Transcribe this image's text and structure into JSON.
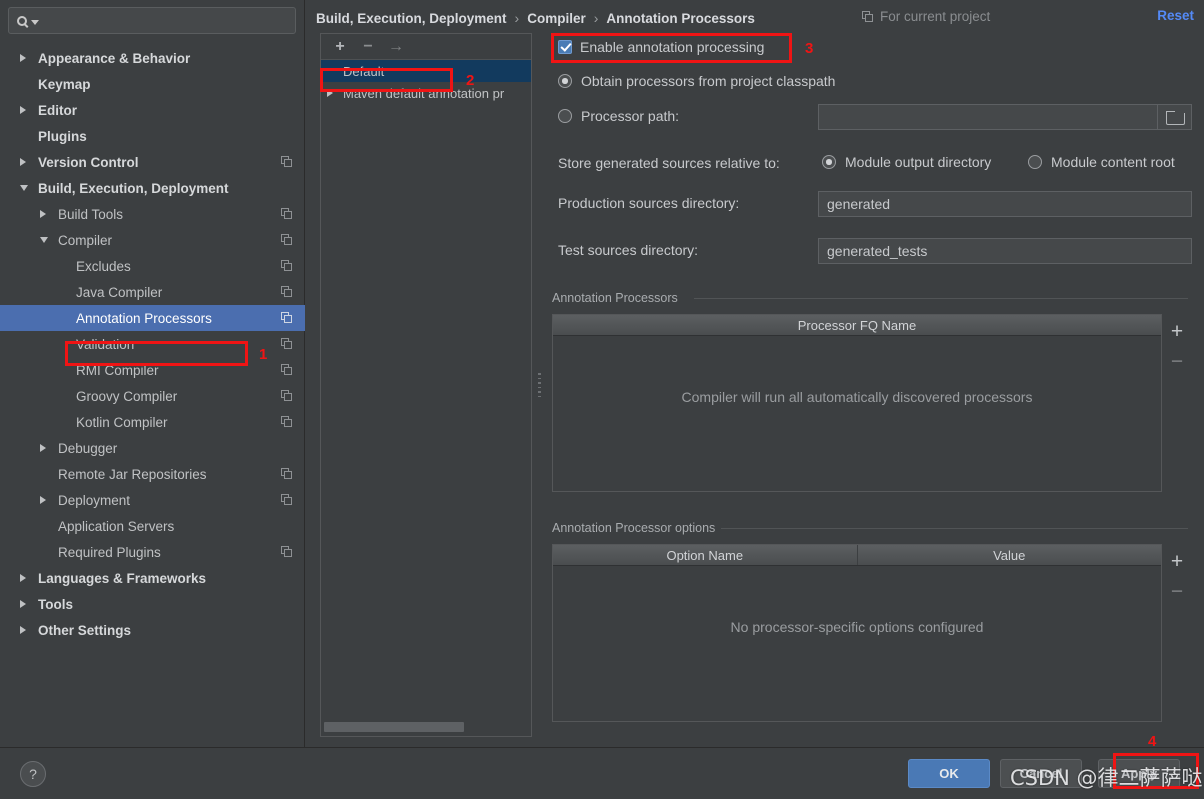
{
  "search": {
    "placeholder": "",
    "value": "",
    "icon": "search-icon"
  },
  "sidebar": {
    "items": [
      {
        "label": "Appearance & Behavior",
        "indent": 0,
        "arrow": "collapsed",
        "bold": true,
        "copy": false,
        "selected": false
      },
      {
        "label": "Keymap",
        "indent": 0,
        "arrow": "none",
        "bold": true,
        "copy": false,
        "selected": false
      },
      {
        "label": "Editor",
        "indent": 0,
        "arrow": "collapsed",
        "bold": true,
        "copy": false,
        "selected": false
      },
      {
        "label": "Plugins",
        "indent": 0,
        "arrow": "none",
        "bold": true,
        "copy": false,
        "selected": false
      },
      {
        "label": "Version Control",
        "indent": 0,
        "arrow": "collapsed",
        "bold": true,
        "copy": true,
        "selected": false
      },
      {
        "label": "Build, Execution, Deployment",
        "indent": 0,
        "arrow": "expanded",
        "bold": true,
        "copy": false,
        "selected": false
      },
      {
        "label": "Build Tools",
        "indent": 1,
        "arrow": "collapsed",
        "bold": false,
        "copy": true,
        "selected": false
      },
      {
        "label": "Compiler",
        "indent": 1,
        "arrow": "expanded",
        "bold": false,
        "copy": true,
        "selected": false
      },
      {
        "label": "Excludes",
        "indent": 2,
        "arrow": "none",
        "bold": false,
        "copy": true,
        "selected": false
      },
      {
        "label": "Java Compiler",
        "indent": 2,
        "arrow": "none",
        "bold": false,
        "copy": true,
        "selected": false
      },
      {
        "label": "Annotation Processors",
        "indent": 2,
        "arrow": "none",
        "bold": false,
        "copy": true,
        "selected": true
      },
      {
        "label": "Validation",
        "indent": 2,
        "arrow": "none",
        "bold": false,
        "copy": true,
        "selected": false
      },
      {
        "label": "RMI Compiler",
        "indent": 2,
        "arrow": "none",
        "bold": false,
        "copy": true,
        "selected": false
      },
      {
        "label": "Groovy Compiler",
        "indent": 2,
        "arrow": "none",
        "bold": false,
        "copy": true,
        "selected": false
      },
      {
        "label": "Kotlin Compiler",
        "indent": 2,
        "arrow": "none",
        "bold": false,
        "copy": true,
        "selected": false
      },
      {
        "label": "Debugger",
        "indent": 1,
        "arrow": "collapsed",
        "bold": false,
        "copy": false,
        "selected": false
      },
      {
        "label": "Remote Jar Repositories",
        "indent": 1,
        "arrow": "none",
        "bold": false,
        "copy": true,
        "selected": false
      },
      {
        "label": "Deployment",
        "indent": 1,
        "arrow": "collapsed",
        "bold": false,
        "copy": true,
        "selected": false
      },
      {
        "label": "Application Servers",
        "indent": 1,
        "arrow": "none",
        "bold": false,
        "copy": false,
        "selected": false
      },
      {
        "label": "Required Plugins",
        "indent": 1,
        "arrow": "none",
        "bold": false,
        "copy": true,
        "selected": false
      },
      {
        "label": "Languages & Frameworks",
        "indent": 0,
        "arrow": "collapsed",
        "bold": true,
        "copy": false,
        "selected": false
      },
      {
        "label": "Tools",
        "indent": 0,
        "arrow": "collapsed",
        "bold": true,
        "copy": false,
        "selected": false
      },
      {
        "label": "Other Settings",
        "indent": 0,
        "arrow": "collapsed",
        "bold": true,
        "copy": false,
        "selected": false
      }
    ]
  },
  "header": {
    "breadcrumb": [
      "Build, Execution, Deployment",
      "Compiler",
      "Annotation Processors"
    ],
    "separator": "›",
    "scope_label": "For current project",
    "reset_label": "Reset"
  },
  "profiles": {
    "toolbar": {
      "add": "+",
      "remove": "−",
      "move": "→"
    },
    "items": [
      {
        "label": "Default",
        "arrow": "none",
        "selected": true
      },
      {
        "label": "Maven default annotation pr",
        "arrow": "collapsed",
        "selected": false
      }
    ]
  },
  "main": {
    "enable_checkbox": {
      "label": "Enable annotation processing",
      "checked": true
    },
    "source_mode": {
      "options": [
        {
          "label": "Obtain processors from project classpath",
          "selected": true
        },
        {
          "label": "Processor path:",
          "selected": false
        }
      ],
      "processor_path_value": "",
      "folder_icon": "folder-icon"
    },
    "store_relative": {
      "label": "Store generated sources relative to:",
      "options": [
        {
          "label": "Module output directory",
          "selected": true
        },
        {
          "label": "Module content root",
          "selected": false
        }
      ]
    },
    "production_sources": {
      "label": "Production sources directory:",
      "value": "generated"
    },
    "test_sources": {
      "label": "Test sources directory:",
      "value": "generated_tests"
    },
    "processors_group": {
      "title": "Annotation Processors",
      "columns": [
        "Processor FQ Name"
      ],
      "rows": [],
      "empty_message": "Compiler will run all automatically discovered processors",
      "buttons": {
        "add": "+",
        "remove": "−"
      }
    },
    "options_group": {
      "title": "Annotation Processor options",
      "columns": [
        "Option Name",
        "Value"
      ],
      "rows": [],
      "empty_message": "No processor-specific options configured",
      "buttons": {
        "add": "+",
        "remove": "−"
      }
    }
  },
  "footer": {
    "help_label": "?",
    "ok_label": "OK",
    "cancel_label": "Cancel",
    "apply_label": "Apply"
  },
  "annotations": {
    "markers": [
      "1",
      "2",
      "3",
      "4"
    ]
  },
  "watermark": {
    "text": "CSDN @律二萨萨哒"
  },
  "colors": {
    "background": "#3c3f41",
    "selection_blue": "#4b6eaf",
    "profile_selection": "#123a5e",
    "accent_link": "#548af7",
    "annotation_red": "#f01414",
    "primary_button": "#4a79b5"
  }
}
